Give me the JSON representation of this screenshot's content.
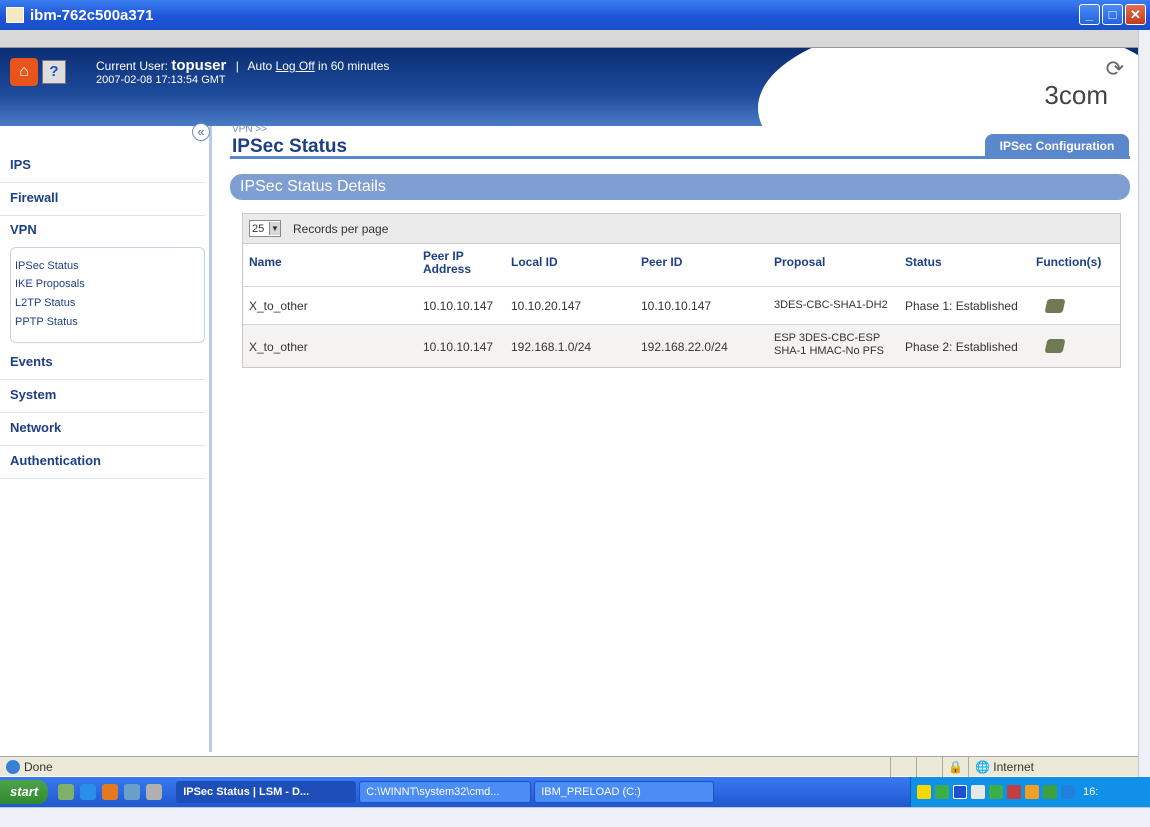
{
  "window": {
    "title": "ibm-762c500a371",
    "minimize": "_",
    "maximize": "□",
    "close": "✕"
  },
  "header": {
    "user_prefix": "Current User: ",
    "user": "topuser",
    "separator": "|",
    "autologoff_prefix": "Auto ",
    "logoff_link": "Log Off",
    "autologoff_suffix": " in 60 minutes",
    "timestamp": "2007-02-08 17:13:54 GMT",
    "logo": "3com",
    "home_icon": "house-icon",
    "help_icon": "help-icon",
    "help_glyph": "?"
  },
  "sidebar": {
    "collapse_glyph": "«",
    "items": [
      "IPS",
      "Firewall",
      "VPN",
      "Events",
      "System",
      "Network",
      "Authentication"
    ],
    "vpn_subitems": [
      "IPSec Status",
      "IKE Proposals",
      "L2TP Status",
      "PPTP Status"
    ]
  },
  "main": {
    "breadcrumb": "VPN >>",
    "title": "IPSec Status",
    "tab_label": "IPSec Configuration",
    "section_title": "IPSec Status Details",
    "records_value": "25",
    "records_label": "Records per page",
    "columns": [
      "Name",
      "Peer IP Address",
      "Local ID",
      "Peer ID",
      "Proposal",
      "Status",
      "Function(s)"
    ],
    "rows": [
      {
        "name": "X_to_other",
        "peer_ip": "10.10.10.147",
        "local_id": "10.10.20.147",
        "peer_id": "10.10.10.147",
        "proposal": "3DES-CBC-SHA1-DH2",
        "status": "Phase 1: Established",
        "function_icon": "hand-tool-icon"
      },
      {
        "name": "X_to_other",
        "peer_ip": "10.10.10.147",
        "local_id": "192.168.1.0/24",
        "peer_id": "192.168.22.0/24",
        "proposal": "ESP 3DES-CBC-ESP SHA-1 HMAC-No PFS",
        "status": "Phase 2: Established",
        "function_icon": "hand-tool-icon"
      }
    ]
  },
  "statusbar": {
    "text": "Done",
    "zone": "Internet"
  },
  "taskbar": {
    "start": "start",
    "tasks": [
      "IPSec Status | LSM - D...",
      "C:\\WINNT\\system32\\cmd...",
      "IBM_PRELOAD (C:)"
    ],
    "clock": "16:"
  },
  "colors": {
    "accent": "#1c3f86",
    "section": "#7f9fd3",
    "tab": "#5b87cc"
  }
}
